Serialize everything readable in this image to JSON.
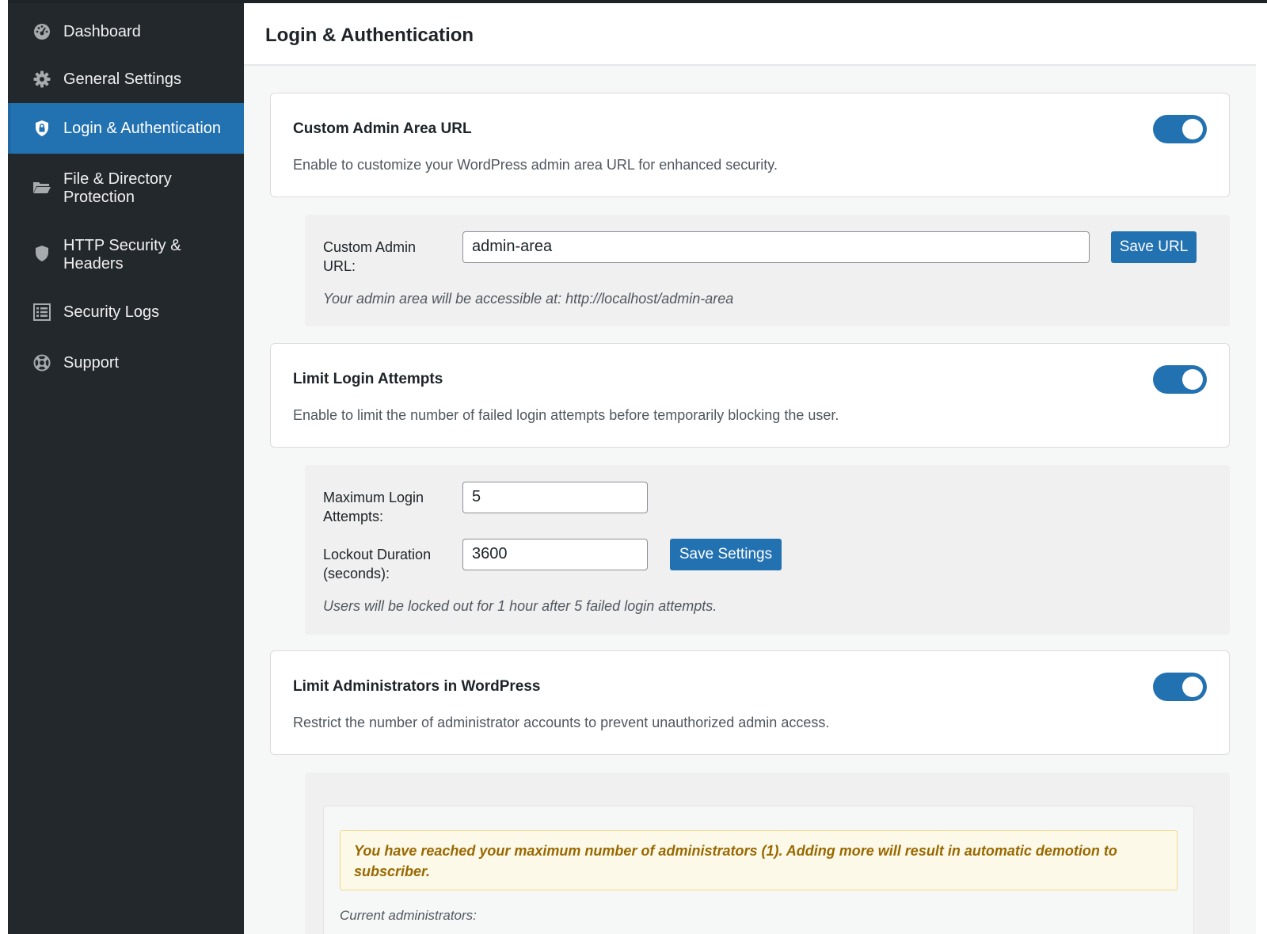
{
  "sidebar": {
    "items": [
      {
        "label": "Dashboard",
        "icon": "dashboard-icon"
      },
      {
        "label": "General Settings",
        "icon": "gear-icon"
      },
      {
        "label": "Login & Authentication",
        "icon": "lock-shield-icon",
        "active": true
      },
      {
        "label_line1": "File & Directory",
        "label_line2": "Protection",
        "icon": "folder-icon"
      },
      {
        "label_line1": "HTTP Security &",
        "label_line2": "Headers",
        "icon": "shield-icon"
      },
      {
        "label": "Security Logs",
        "icon": "list-icon"
      },
      {
        "label": "Support",
        "icon": "lifebuoy-icon"
      }
    ]
  },
  "header": {
    "title": "Login & Authentication"
  },
  "sections": {
    "custom_admin_url": {
      "title": "Custom Admin Area URL",
      "description": "Enable to customize your WordPress admin area URL for enhanced security.",
      "enabled": true,
      "field_label_line1": "Custom Admin",
      "field_label_line2": "URL:",
      "value": "admin-area",
      "button": "Save URL",
      "hint": "Your admin area will be accessible at: http://localhost/admin-area"
    },
    "limit_login": {
      "title": "Limit Login Attempts",
      "description": "Enable to limit the number of failed login attempts before temporarily blocking the user.",
      "enabled": true,
      "max_label_line1": "Maximum Login",
      "max_label_line2": "Attempts:",
      "max_value": "5",
      "lockout_label_line1": "Lockout Duration",
      "lockout_label_line2": "(seconds):",
      "lockout_value": "3600",
      "button": "Save Settings",
      "hint": "Users will be locked out for 1 hour after 5 failed login attempts."
    },
    "limit_admins": {
      "title": "Limit Administrators in WordPress",
      "description": "Restrict the number of administrator accounts to prevent unauthorized admin access.",
      "enabled": true,
      "notice": "You have reached your maximum number of administrators (1). Adding more will result in automatic demotion to subscriber.",
      "current_label": "Current administrators:"
    }
  },
  "colors": {
    "accent": "#2271b1",
    "sidebar_bg": "#23282d",
    "notice_text": "#996800",
    "notice_bg": "#fcf9e8"
  }
}
